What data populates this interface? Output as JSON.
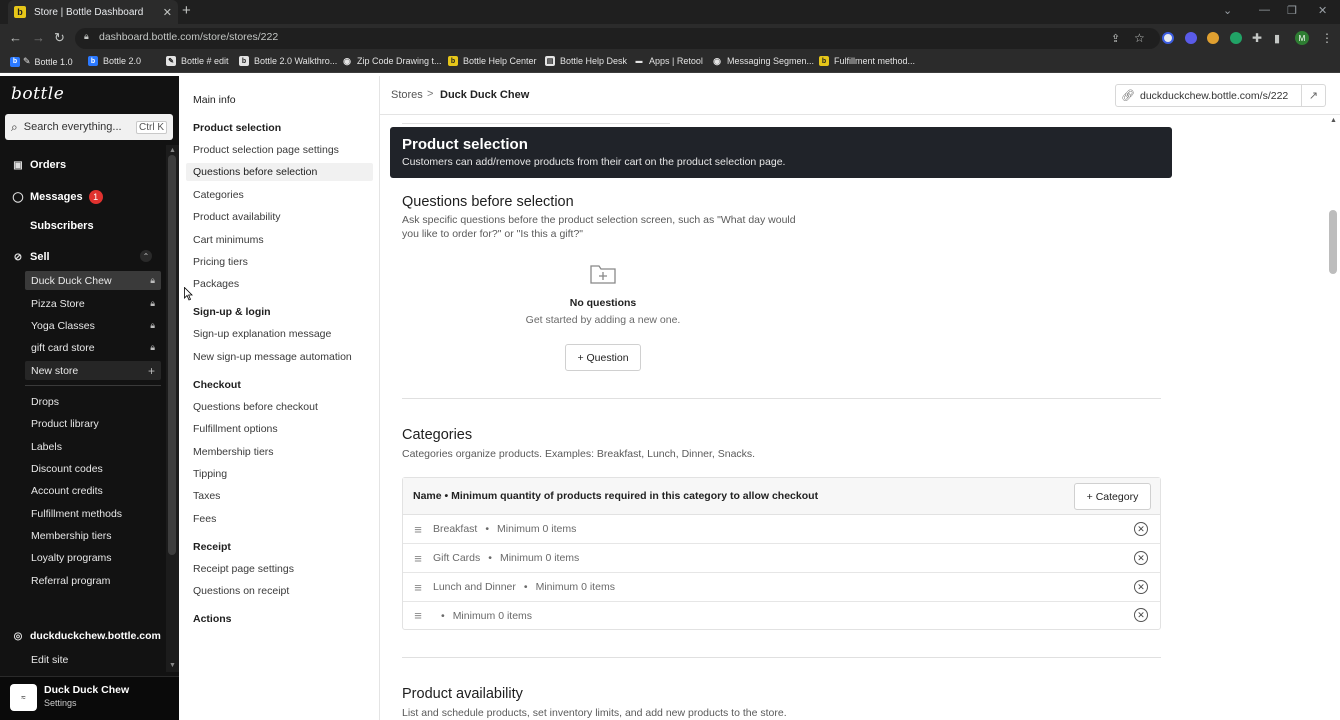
{
  "browser": {
    "tab_title": "Store | Bottle Dashboard",
    "tab_close": "✕",
    "new_tab": "+",
    "url": "dashboard.bottle.com/store/stores/222",
    "avatar_letter": "M",
    "bookmarks": [
      "Bottle 1.0",
      "Bottle 2.0",
      "Bottle # edit",
      "Bottle 2.0 Walkthro...",
      "Zip Code Drawing t...",
      "Bottle Help Center",
      "Bottle Help Desk",
      "Apps | Retool",
      "Messaging Segmen...",
      "Fulfillment method..."
    ]
  },
  "app": {
    "logo": "bottle",
    "search": {
      "placeholder": "Search everything...",
      "shortcut": "Ctrl K"
    },
    "nav": {
      "orders": "Orders",
      "messages": "Messages",
      "messages_badge": "1",
      "subscribers": "Subscribers",
      "sell": "Sell",
      "stores": [
        "Duck Duck Chew",
        "Pizza Store",
        "Yoga Classes",
        "gift card store"
      ],
      "new_store": "New store",
      "links": [
        "Drops",
        "Product library",
        "Labels",
        "Discount codes",
        "Account credits",
        "Fulfillment methods",
        "Membership tiers",
        "Loyalty programs",
        "Referral program"
      ],
      "domain": "duckduckchew.bottle.com",
      "edit_site": "Edit site"
    },
    "footer": {
      "name": "Duck Duck Chew",
      "sub": "Settings",
      "icon_text": "≈"
    }
  },
  "settings_nav": {
    "main_info": "Main info",
    "product_selection": "Product selection",
    "ps_items": [
      "Product selection page settings",
      "Questions before selection",
      "Categories",
      "Product availability",
      "Cart minimums",
      "Pricing tiers",
      "Packages"
    ],
    "signup": "Sign-up & login",
    "signup_items": [
      "Sign-up explanation message",
      "New sign-up message automation"
    ],
    "checkout": "Checkout",
    "checkout_items": [
      "Questions before checkout",
      "Fulfillment options",
      "Membership tiers",
      "Tipping",
      "Taxes",
      "Fees"
    ],
    "receipt": "Receipt",
    "receipt_items": [
      "Receipt page settings",
      "Questions on receipt"
    ],
    "actions": "Actions"
  },
  "header": {
    "crumb_stores": "Stores",
    "crumb_sep": ">",
    "crumb_current": "Duck Duck Chew",
    "store_url": "duckduckchew.bottle.com/s/222"
  },
  "main": {
    "banner_title": "Product selection",
    "banner_sub": "Customers can add/remove products from their cart on the product selection page.",
    "qbs_title": "Questions before selection",
    "qbs_desc_1": "Ask specific questions before the product selection screen, such as \"What day would",
    "qbs_desc_2": "you like to order for?\" or \"Is this a gift?\"",
    "no_questions": "No questions",
    "no_questions_sub": "Get started by adding a new one.",
    "add_question": "+ Question",
    "categories_title": "Categories",
    "categories_desc": "Categories organize products. Examples: Breakfast, Lunch, Dinner, Snacks.",
    "cat_header": "Name  •  Minimum quantity of products required in this category to allow checkout",
    "add_category": "+ Category",
    "categories": [
      {
        "name": "Breakfast",
        "min": "Minimum 0 items"
      },
      {
        "name": "Gift Cards",
        "min": "Minimum 0 items"
      },
      {
        "name": "Lunch and Dinner",
        "min": "Minimum 0 items"
      },
      {
        "name": "",
        "min": "Minimum 0 items"
      }
    ],
    "pa_title": "Product availability",
    "pa_desc": "List and schedule products, set inventory limits, and add new products to the store."
  },
  "colors": {
    "banner_bg": "#202329",
    "sidebar_bg": "#121212",
    "badge": "#e0322f",
    "bottle_favicon": "#e6c619"
  }
}
